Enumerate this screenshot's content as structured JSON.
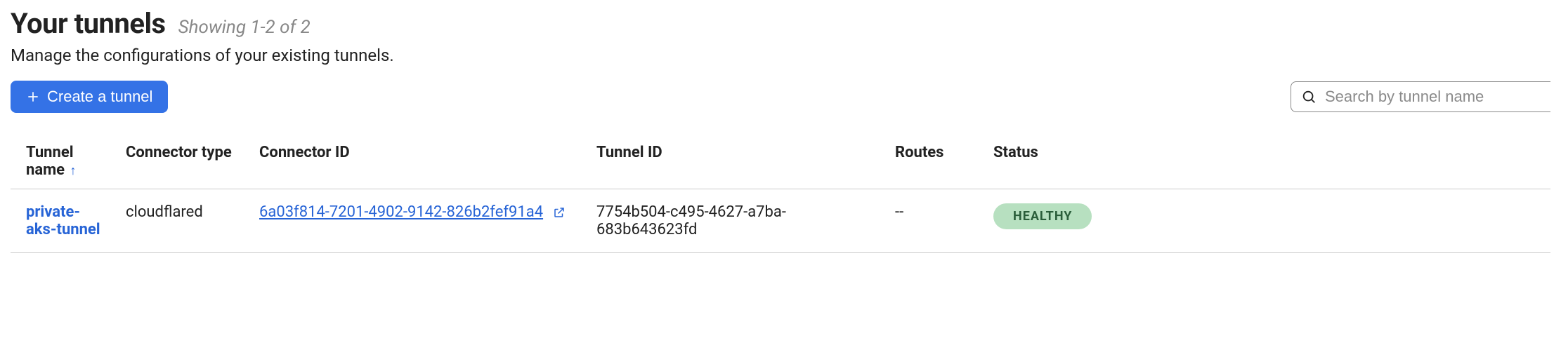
{
  "header": {
    "title": "Your tunnels",
    "subtitle": "Showing 1-2 of 2",
    "description": "Manage the configurations of your existing tunnels."
  },
  "actions": {
    "create_label": "Create a tunnel"
  },
  "search": {
    "placeholder": "Search by tunnel name",
    "value": ""
  },
  "table": {
    "columns": {
      "name": "Tunnel name",
      "connector_type": "Connector type",
      "connector_id": "Connector ID",
      "tunnel_id": "Tunnel ID",
      "routes": "Routes",
      "status": "Status"
    },
    "rows": [
      {
        "name": "private-aks-tunnel",
        "connector_type": "cloudflared",
        "connector_id": "6a03f814-7201-4902-9142-826b2fef91a4",
        "tunnel_id": "7754b504-c495-4627-a7ba-683b643623fd",
        "routes": "--",
        "status": "HEALTHY"
      }
    ]
  }
}
